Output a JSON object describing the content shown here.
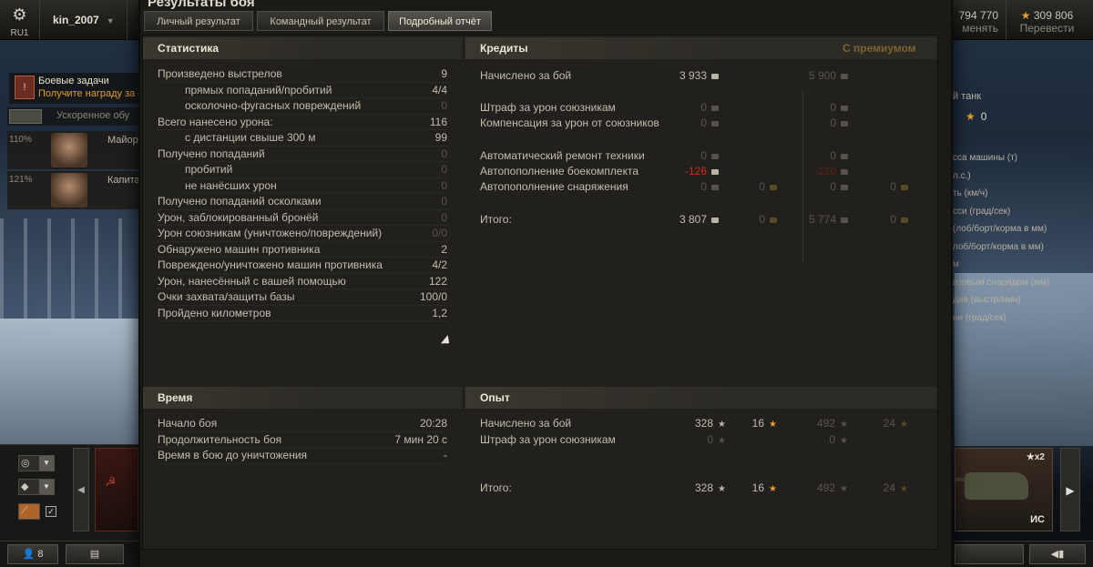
{
  "topbar": {
    "server_icon": "gear-icon",
    "server": "RU1",
    "username": "kin_2007",
    "credits_value": "794 770",
    "credits_action": "менять",
    "gold_value": "309 806",
    "gold_action": "Перевести"
  },
  "hangar_left": {
    "quest_title": "Боевые задачи",
    "quest_subtitle": "Получите награду за е",
    "crew_bar_text": "Ускоренное обу",
    "crew": [
      {
        "percent": "110%",
        "rank": "Майор С"
      },
      {
        "percent": "121%",
        "rank": "Капитан"
      }
    ]
  },
  "hangar_right": {
    "tank_type": "й танк",
    "stars": "0",
    "stats": [
      "сса машины (т)",
      "л.с.)",
      "ть (км/ч)",
      "сси (град/сек)",
      "(лоб/борт/корма в мм)",
      "лоб/борт/корма в мм)",
      "м",
      "азовым снарядом (мм)",
      "дия (выстр/мин)",
      "ни (град/сек)"
    ],
    "tank_name": "ИС",
    "tank_badge": "x2"
  },
  "bottom": {
    "friends_count": "8"
  },
  "dialog": {
    "title": "Результаты боя",
    "tabs": [
      "Личный результат",
      "Командный результат",
      "Подробный отчёт"
    ],
    "active_tab": 2
  },
  "stats": {
    "header": "Статистика",
    "rows": [
      {
        "label": "Произведено выстрелов",
        "value": "9",
        "indent": false,
        "dim": false
      },
      {
        "label": "прямых попаданий/пробитий",
        "value": "4/4",
        "indent": true,
        "dim": false
      },
      {
        "label": "осколочно-фугасных повреждений",
        "value": "0",
        "indent": true,
        "dim": true
      },
      {
        "label": "Всего нанесено урона:",
        "value": "116",
        "indent": false,
        "dim": false
      },
      {
        "label": "с дистанции свыше 300 м",
        "value": "99",
        "indent": true,
        "dim": false
      },
      {
        "label": "Получено попаданий",
        "value": "0",
        "indent": false,
        "dim": true
      },
      {
        "label": "пробитий",
        "value": "0",
        "indent": true,
        "dim": true
      },
      {
        "label": "не нанёсших урон",
        "value": "0",
        "indent": true,
        "dim": true
      },
      {
        "label": "Получено попаданий осколками",
        "value": "0",
        "indent": false,
        "dim": true
      },
      {
        "label": "Урон, заблокированный бронёй",
        "value": "0",
        "indent": false,
        "dim": true
      },
      {
        "label": "Урон союзникам (уничтожено/повреждений)",
        "value": "0/0",
        "indent": false,
        "dim": true
      },
      {
        "label": "Обнаружено машин противника",
        "value": "2",
        "indent": false,
        "dim": false
      },
      {
        "label": "Повреждено/уничтожено машин противника",
        "value": "4/2",
        "indent": false,
        "dim": false
      },
      {
        "label": "Урон, нанесённый с вашей помощью",
        "value": "122",
        "indent": false,
        "dim": false
      },
      {
        "label": "Очки захвата/защиты базы",
        "value": "100/0",
        "indent": false,
        "dim": false
      },
      {
        "label": "Пройдено километров",
        "value": "1,2",
        "indent": false,
        "dim": false
      }
    ]
  },
  "credits": {
    "header": "Кредиты",
    "premium_header": "С премиумом",
    "rows": [
      {
        "label": "Начислено за бой",
        "value": "3 933",
        "gold": "",
        "prem": "5 900",
        "prem_gold": "",
        "dim": false
      },
      {
        "label": "Штраф за урон союзникам",
        "value": "0",
        "gold": "",
        "prem": "0",
        "prem_gold": "",
        "dim": true
      },
      {
        "label": "Компенсация за урон от союзников",
        "value": "0",
        "gold": "",
        "prem": "0",
        "prem_gold": "",
        "dim": true
      },
      {
        "label": "Автоматический ремонт техники",
        "value": "0",
        "gold": "",
        "prem": "0",
        "prem_gold": "",
        "dim": true
      },
      {
        "label": "Автопополнение боекомплекта",
        "value": "-126",
        "gold": "",
        "prem": "-126",
        "prem_gold": "",
        "dim": false,
        "negative": true
      },
      {
        "label": "Автопополнение снаряжения",
        "value": "0",
        "gold": "0",
        "prem": "0",
        "prem_gold": "0",
        "dim": true
      },
      {
        "label": "Итого:",
        "value": "3 807",
        "gold": "0",
        "prem": "5 774",
        "prem_gold": "0",
        "dim": false
      }
    ]
  },
  "time": {
    "header": "Время",
    "rows": [
      {
        "label": "Начало боя",
        "value": "20:28"
      },
      {
        "label": "Продолжительность боя",
        "value": "7 мин 20 с"
      },
      {
        "label": "Время в бою до уничтожения",
        "value": "-"
      }
    ]
  },
  "experience": {
    "header": "Опыт",
    "rows": [
      {
        "label": "Начислено за бой",
        "value": "328",
        "free": "16",
        "prem": "492",
        "prem_free": "24",
        "dim": false
      },
      {
        "label": "Штраф за урон союзникам",
        "value": "0",
        "free": "",
        "prem": "0",
        "prem_free": "",
        "dim": true
      },
      {
        "label": "Итого:",
        "value": "328",
        "free": "16",
        "prem": "492",
        "prem_free": "24",
        "dim": false
      }
    ]
  },
  "colors": {
    "negative": "#d62b1e",
    "gold": "#e39c2f",
    "premium_header": "#7b6434"
  }
}
